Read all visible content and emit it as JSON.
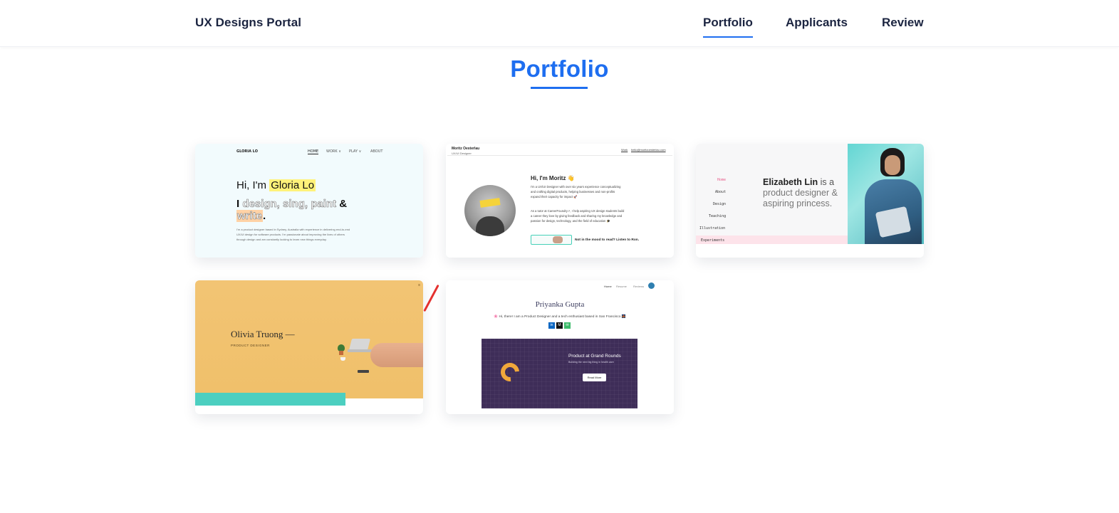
{
  "header": {
    "brand": "UX Designs Portal",
    "nav": [
      {
        "label": "Portfolio",
        "active": true
      },
      {
        "label": "Applicants",
        "active": false
      },
      {
        "label": "Review",
        "active": false
      }
    ]
  },
  "page": {
    "title": "Portfolio",
    "accent_color": "#1e6ef0"
  },
  "cards": [
    {
      "name": "Gloria Lo",
      "logo": "GLORIA LO",
      "nav": [
        "HOME",
        "WORK ∨",
        "PLAY ∨",
        "ABOUT"
      ],
      "greeting_prefix": "Hi, I'm ",
      "greeting_name": "Gloria Lo",
      "line2_prefix": "I ",
      "line2_words": "design, sing, paint",
      "line2_suffix": " &",
      "line3_word": "write",
      "line3_suffix": ".",
      "bio": [
        "I'm a product designer based in Sydney, Australia with experience in delivering end-to-end",
        "UX/UI design for software products. I'm passionate about improving the lives of others",
        "through design and am constantly looking to learn new things everyday."
      ]
    },
    {
      "name": "Moritz Oesterlau",
      "role": "UX/UI Designer",
      "nav_work": "Work",
      "nav_email": "hello@moritzoesterlau.com",
      "heading": "Hi, I'm Moritz 👋",
      "para1": [
        "I'm a UX/UI Designer with over six years experience conceptualizing",
        "and crafting digital products, helping businesses and non-profits",
        "expand their capacity for impact 🚀"
      ],
      "para2": [
        "As a tutor at CareerFoundry↗, I help aspiring UX design students build",
        "a career they love by giving feedback and sharing my knowledge and",
        "passion for design, technology, and the field of education 🎓"
      ],
      "cta": "Not in the mood to read? Listen to Ron."
    },
    {
      "name": "Elizabeth Lin",
      "tagline_rest": " is a",
      "tagline_lines": [
        "product designer &",
        "aspiring princess."
      ],
      "side_nav": [
        "Home",
        "About",
        "Design",
        "Teaching",
        "Illustration",
        "Experiments"
      ]
    },
    {
      "name": "Olivia Truong —",
      "role": "PRODUCT DESIGNER"
    },
    {
      "name": "Priyanka Gupta",
      "nav": [
        "Home",
        "Resume",
        "Reviews"
      ],
      "intro": "🌸 Hi, there! I am a Product Designer and a tech enthusiast based in San Francisco 🌉",
      "social": [
        "in",
        "M",
        "✉"
      ],
      "feature_title": "Product at Grand Rounds",
      "feature_sub": "Building the next big thing in health care",
      "feature_button": "Read More"
    }
  ]
}
